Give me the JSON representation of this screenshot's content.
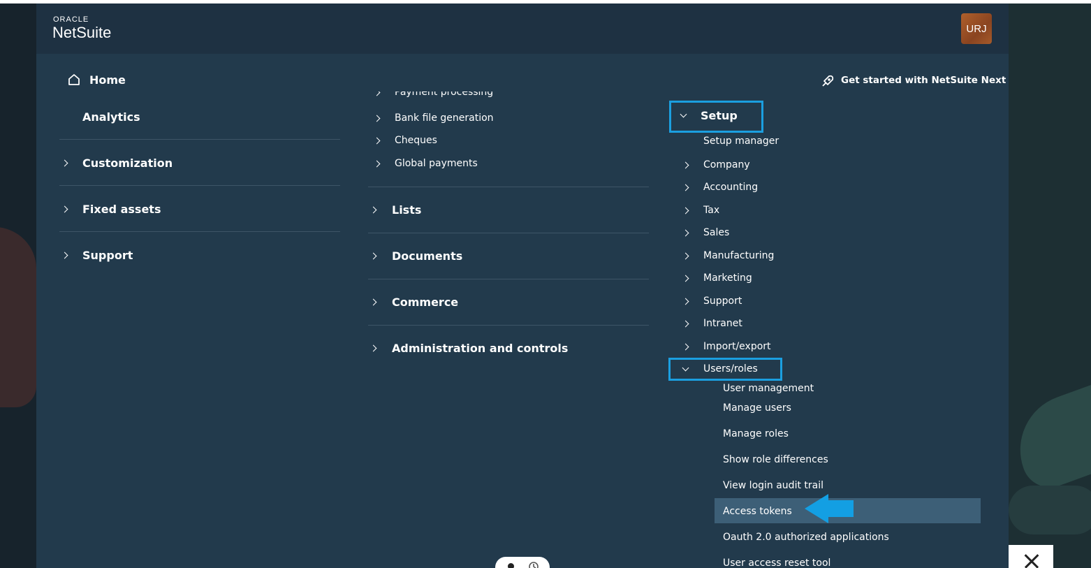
{
  "header": {
    "logo_brand": "ORACLE",
    "logo_product": "NetSuite",
    "avatar_initials": "URJ"
  },
  "get_started": "Get started with NetSuite Next",
  "col1": {
    "home": "Home",
    "analytics": "Analytics",
    "customization": "Customization",
    "fixed_assets": "Fixed assets",
    "support": "Support"
  },
  "col2": {
    "payment_processing": "Payment processing",
    "bank_file_generation": "Bank file generation",
    "cheques": "Cheques",
    "global_payments": "Global payments",
    "lists": "Lists",
    "documents": "Documents",
    "commerce": "Commerce",
    "administration": "Administration and controls"
  },
  "col3": {
    "setup": "Setup",
    "setup_manager": "Setup manager",
    "company": "Company",
    "accounting": "Accounting",
    "tax": "Tax",
    "sales": "Sales",
    "manufacturing": "Manufacturing",
    "marketing": "Marketing",
    "support": "Support",
    "intranet": "Intranet",
    "import_export": "Import/export",
    "users_roles": "Users/roles",
    "user_management": "User management",
    "manage_users": "Manage users",
    "manage_roles": "Manage roles",
    "show_role_differences": "Show role differences",
    "view_login_audit_trail": "View login audit trail",
    "access_tokens": "Access tokens",
    "oauth_apps": "Oauth 2.0 authorized applications",
    "user_access_reset": "User access reset tool"
  },
  "colors": {
    "panel": "#223a4c",
    "highlight_border": "#1b9fe0",
    "selected_row": "#3d5f77",
    "arrow": "#139fe3"
  }
}
